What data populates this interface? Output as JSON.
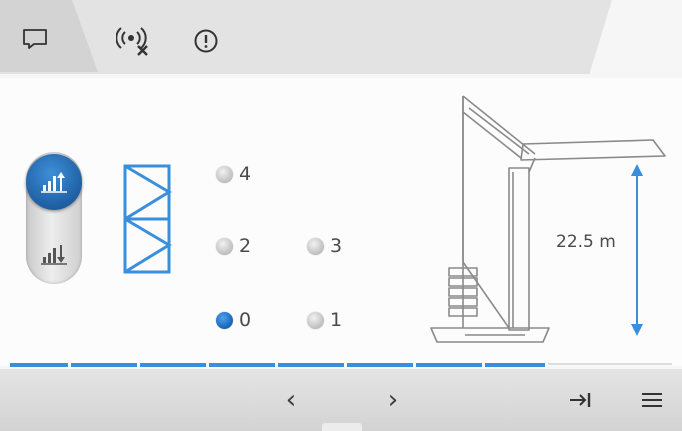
{
  "tabs": [
    {
      "icon": "message-icon",
      "active": true
    },
    {
      "icon": "signal-off-icon",
      "active": false
    },
    {
      "icon": "info-icon",
      "active": false
    }
  ],
  "mode_toggle": {
    "options": [
      "raise-mast-icon",
      "lower-mast-icon"
    ],
    "active": "raise-mast-icon"
  },
  "mast_icon": "mast-section-icon",
  "levels": {
    "options": [
      {
        "label": "4",
        "selected": false
      },
      {
        "label": "2",
        "selected": false
      },
      {
        "label": "3",
        "selected": false
      },
      {
        "label": "0",
        "selected": true
      },
      {
        "label": "1",
        "selected": false
      }
    ]
  },
  "crane": {
    "height_label": "22.5 m"
  },
  "progress": {
    "segments_total": 8,
    "segments_filled": 8
  },
  "nav": {
    "prev_label": "‹",
    "next_label": "›",
    "skip_icon": "skip-to-end-icon",
    "menu_icon": "menu-icon"
  },
  "colors": {
    "accent": "#2f86d6",
    "active_toggle": "#1f5fa3",
    "tab_bar": "#e2e2e2"
  }
}
